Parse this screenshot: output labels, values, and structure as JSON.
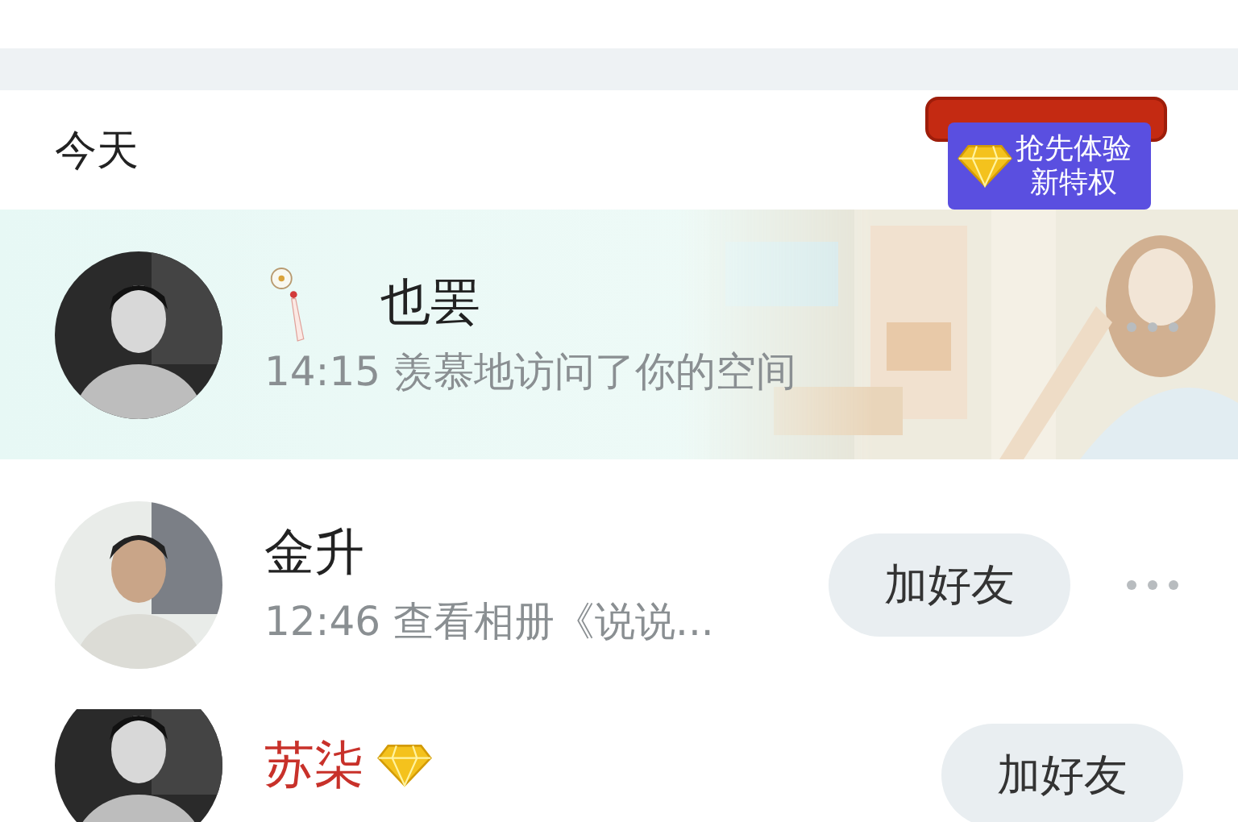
{
  "section_header": "今天",
  "promo_badge": {
    "lines": [
      "抢先体验",
      "新特权"
    ]
  },
  "visitors": [
    {
      "kind": "decorated",
      "name": "也罢",
      "vip": false,
      "detail": "14:15 羡慕地访问了你的空间"
    },
    {
      "kind": "plain",
      "name": "金升",
      "vip": false,
      "detail": "12:46 查看相册《说说...",
      "button": "加好友"
    },
    {
      "kind": "plain",
      "name": "苏柒",
      "vip": true,
      "button": "加好友"
    }
  ]
}
